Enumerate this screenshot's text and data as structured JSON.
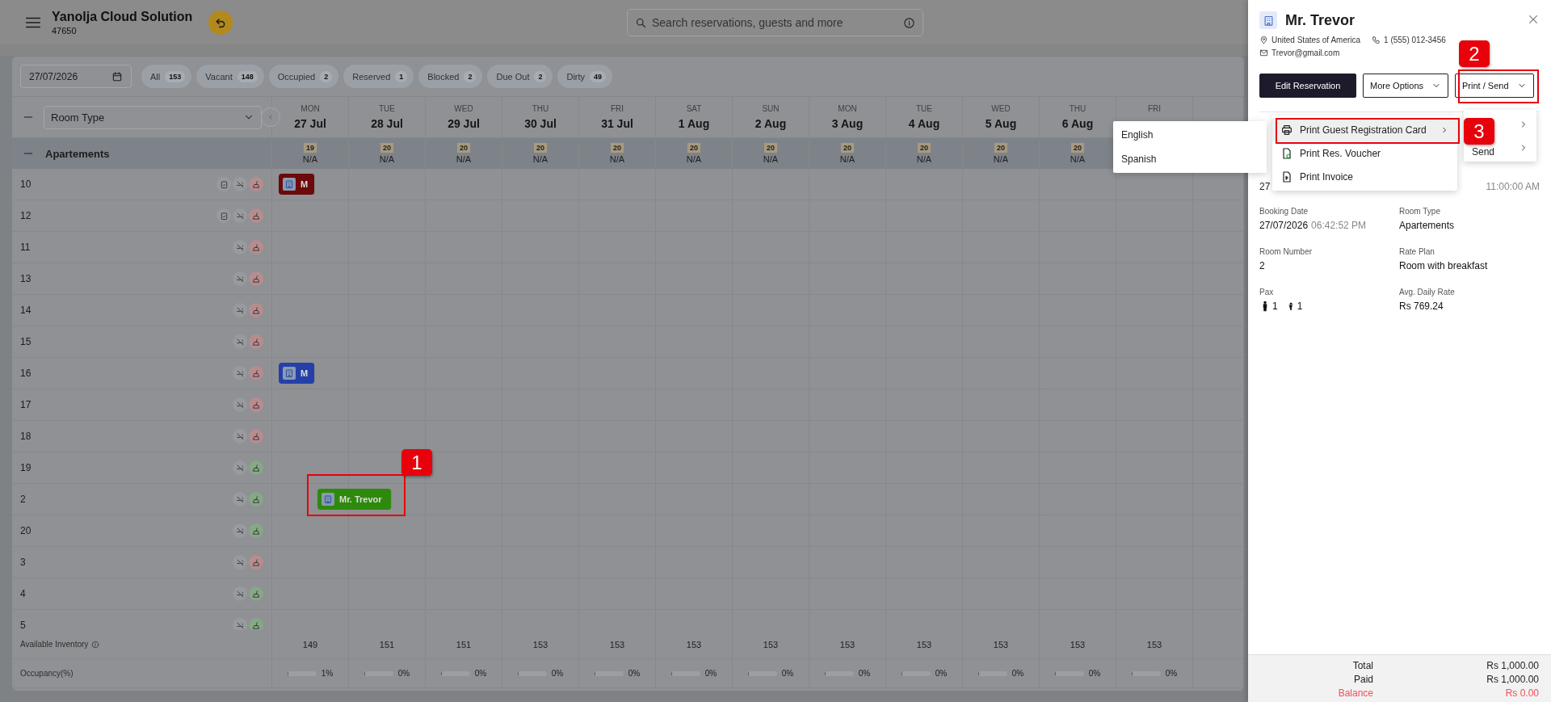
{
  "header": {
    "title": "Yanolja Cloud Solution",
    "subtitle": "47650",
    "search": {
      "placeholder": "Search reservations, guests and more"
    }
  },
  "toolbar": {
    "date": "27/07/2026",
    "filters": [
      {
        "label": "All",
        "count": "153"
      },
      {
        "label": "Vacant",
        "count": "148"
      },
      {
        "label": "Occupied",
        "count": "2"
      },
      {
        "label": "Reserved",
        "count": "1"
      },
      {
        "label": "Blocked",
        "count": "2"
      },
      {
        "label": "Due Out",
        "count": "2"
      },
      {
        "label": "Dirty",
        "count": "49"
      }
    ]
  },
  "grid": {
    "room_type_select": "Room Type",
    "days": [
      {
        "weekday": "MON",
        "date": "27 Jul"
      },
      {
        "weekday": "TUE",
        "date": "28 Jul"
      },
      {
        "weekday": "WED",
        "date": "29 Jul"
      },
      {
        "weekday": "THU",
        "date": "30 Jul"
      },
      {
        "weekday": "FRI",
        "date": "31 Jul"
      },
      {
        "weekday": "SAT",
        "date": "1 Aug"
      },
      {
        "weekday": "SUN",
        "date": "2 Aug"
      },
      {
        "weekday": "MON",
        "date": "3 Aug"
      },
      {
        "weekday": "TUE",
        "date": "4 Aug"
      },
      {
        "weekday": "WED",
        "date": "5 Aug"
      },
      {
        "weekday": "THU",
        "date": "6 Aug"
      },
      {
        "weekday": "FRI"
      }
    ],
    "group": {
      "name": "Apartements",
      "cells": [
        {
          "count": "19",
          "rate": "N/A"
        },
        {
          "count": "20",
          "rate": "N/A"
        },
        {
          "count": "20",
          "rate": "N/A"
        },
        {
          "count": "20",
          "rate": "N/A"
        },
        {
          "count": "20",
          "rate": "N/A"
        },
        {
          "count": "20",
          "rate": "N/A"
        },
        {
          "count": "20",
          "rate": "N/A"
        },
        {
          "count": "20",
          "rate": "N/A"
        },
        {
          "count": "20",
          "rate": "N/A"
        },
        {
          "count": "20",
          "rate": "N/A"
        },
        {
          "count": "20",
          "rate": "N/A"
        }
      ]
    },
    "rooms": [
      {
        "number": "10",
        "task": true,
        "dirty": true,
        "bookings": [
          {
            "guest": "M",
            "color": "#6b0a0a",
            "continues_before": true
          }
        ]
      },
      {
        "number": "12",
        "task": true,
        "dirty": true
      },
      {
        "number": "11",
        "task": false,
        "dirty": true
      },
      {
        "number": "13",
        "task": false,
        "dirty": true
      },
      {
        "number": "14",
        "task": false,
        "dirty": true
      },
      {
        "number": "15",
        "task": false,
        "dirty": true
      },
      {
        "number": "16",
        "task": false,
        "dirty": true,
        "bookings": [
          {
            "guest": "M",
            "color": "#2440a8",
            "continues_before": true
          }
        ]
      },
      {
        "number": "17",
        "task": false,
        "dirty": true
      },
      {
        "number": "18",
        "task": false,
        "dirty": true
      },
      {
        "number": "19",
        "task": false,
        "dirty": false
      },
      {
        "number": "2",
        "task": false,
        "dirty": false,
        "bookings": [
          {
            "guest": "Mr. Trevor",
            "color": "#2e8a0c",
            "continues_before": false
          }
        ]
      },
      {
        "number": "20",
        "task": false,
        "dirty": false
      },
      {
        "number": "3",
        "task": false,
        "dirty": true
      },
      {
        "number": "4",
        "task": false,
        "dirty": false
      },
      {
        "number": "5",
        "task": false,
        "dirty": false
      }
    ],
    "inventory": {
      "label": "Available Inventory",
      "values": [
        "149",
        "151",
        "151",
        "153",
        "153",
        "153",
        "153",
        "153",
        "153",
        "153",
        "153",
        "153"
      ]
    },
    "occupancy": {
      "label": "Occupancy(%)",
      "cells": [
        {
          "level": 0.03,
          "reading": "1%"
        },
        {
          "level": 0,
          "reading": "0%"
        },
        {
          "level": 0,
          "reading": "0%"
        },
        {
          "level": 0,
          "reading": "0%"
        },
        {
          "level": 0,
          "reading": "0%"
        },
        {
          "level": 0,
          "reading": "0%"
        },
        {
          "level": 0,
          "reading": "0%"
        },
        {
          "level": 0,
          "reading": "0%"
        },
        {
          "level": 0,
          "reading": "0%"
        },
        {
          "level": 0,
          "reading": "0%"
        },
        {
          "level": 0,
          "reading": "0%"
        },
        {
          "level": 0,
          "reading": "0%"
        }
      ]
    }
  },
  "language_menu": {
    "items": [
      {
        "label": "English"
      },
      {
        "label": "Spanish"
      }
    ]
  },
  "panel": {
    "guest": "Mr. Trevor",
    "country": "United States of America",
    "phone": "1 (555) 012-3456",
    "email": "Trevor@gmail.com",
    "buttons": [
      {
        "label": "Edit Reservation",
        "kind": "primary"
      },
      {
        "label": "More Options",
        "kind": "dropdown"
      },
      {
        "label": "Print / Send",
        "kind": "dropdown"
      }
    ],
    "print_send_menu": {
      "items": [
        {
          "kind": "submenu"
        },
        {
          "kind": "submenu",
          "label": "Send"
        }
      ]
    },
    "print_menu": {
      "items": [
        {
          "label": "Print Guest Registration Card",
          "kind": "printer",
          "selected": true,
          "submenu": true
        },
        {
          "label": "Print Res. Voucher",
          "kind": "voucher",
          "selected": false,
          "submenu": false
        },
        {
          "label": "Print Invoice",
          "kind": "invoice",
          "selected": false,
          "submenu": false
        }
      ]
    },
    "partial_values": [
      {
        "value": "27"
      },
      {
        "value": "11:00:00 AM",
        "kind": "time"
      }
    ],
    "details": [
      {
        "label": "Booking Date",
        "value": "27/07/2026",
        "time": "06:42:52 PM"
      },
      {
        "label": "Room Type",
        "value": "Apartements"
      },
      {
        "label": "Room Number",
        "value": "2"
      },
      {
        "label": "Rate Plan",
        "value": "Room with breakfast"
      },
      {
        "label": "Pax",
        "kind": "pax",
        "adults": "1",
        "children": "1"
      },
      {
        "label": "Avg. Daily Rate",
        "value": "Rs 769.24"
      }
    ],
    "totals": [
      {
        "label": "Total",
        "value": "Rs 1,000.00",
        "kind": "normal"
      },
      {
        "label": "Paid",
        "value": "Rs 1,000.00",
        "kind": "normal"
      },
      {
        "label": "Balance",
        "value": "Rs 0.00",
        "kind": "balance"
      }
    ]
  },
  "annotations": [
    {
      "label": "1"
    },
    {
      "label": "2"
    },
    {
      "label": "3"
    }
  ]
}
